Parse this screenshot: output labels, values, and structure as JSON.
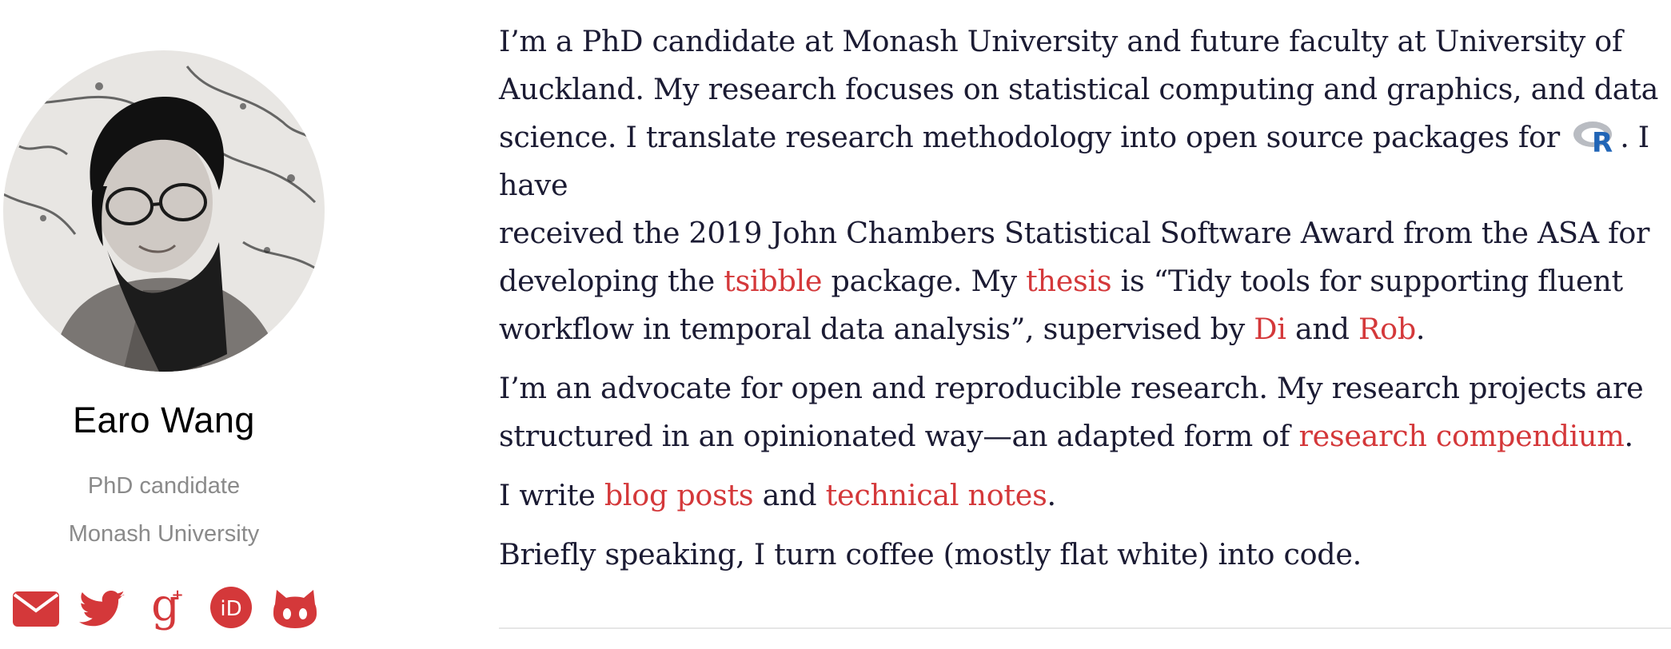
{
  "profile": {
    "name": "Earo Wang",
    "role": "PhD candidate",
    "organization": "Monash University"
  },
  "social": [
    {
      "icon": "envelope-icon",
      "label": "Email"
    },
    {
      "icon": "twitter-icon",
      "label": "Twitter"
    },
    {
      "icon": "google-scholar-icon",
      "label": "Google Scholar"
    },
    {
      "icon": "orcid-icon",
      "label": "ORCID"
    },
    {
      "icon": "github-icon",
      "label": "GitHub"
    }
  ],
  "bio": {
    "p1": {
      "l1": "I’m a PhD candidate at Monash University and future faculty at University of",
      "l2": "Auckland. My research focuses on statistical computing and graphics, and data",
      "l3a": "science. I translate research methodology into open source packages for ",
      "r_icon": "r-logo-icon",
      "l3b": ". I have",
      "l4": "received the 2019 John Chambers Statistical Software Award from the ASA for",
      "l5a": "developing the ",
      "link_tsibble": "tsibble",
      "l5b": " package. My ",
      "link_thesis": "thesis",
      "l5c": " is “Tidy tools for supporting fluent",
      "l6a": "workflow in temporal data analysis”, supervised by ",
      "link_di": "Di",
      "l6b": " and ",
      "link_rob": "Rob",
      "l6c": "."
    },
    "p2": {
      "l1": "I’m an advocate for open and reproducible research. My research projects are",
      "l2a": "structured in an opinionated way—an adapted form of ",
      "link_compendium": "research compendium",
      "l2b": "."
    },
    "p3": {
      "a": "I write ",
      "link_blog": "blog posts",
      "b": " and ",
      "link_notes": "technical notes",
      "c": "."
    },
    "p4": {
      "text": "Briefly speaking, I turn coffee (mostly flat white) into code."
    }
  },
  "colors": {
    "accent": "#d4383a",
    "text": "#1b1b33",
    "muted": "#8a8a8a",
    "divider": "#e6e6e6"
  }
}
